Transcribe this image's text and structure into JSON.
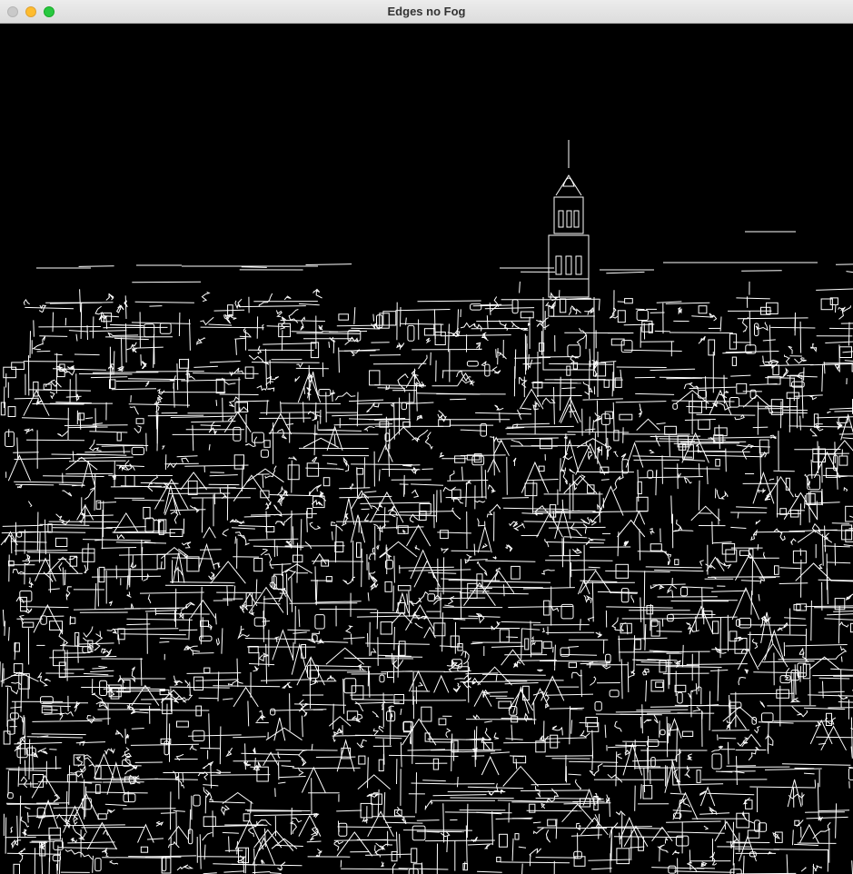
{
  "window": {
    "title": "Edges no Fog",
    "buttons": {
      "close": "close-button",
      "minimize": "minimize-button",
      "zoom": "zoom-button"
    }
  },
  "image": {
    "description_kind": "canny-edge-map",
    "background": "#000000",
    "edge_color": "#ffffff"
  },
  "colors": {
    "titlebar": "#e3e3e3",
    "close": "#c9c9c9",
    "minimize": "#febc2e",
    "zoom": "#28c840"
  }
}
